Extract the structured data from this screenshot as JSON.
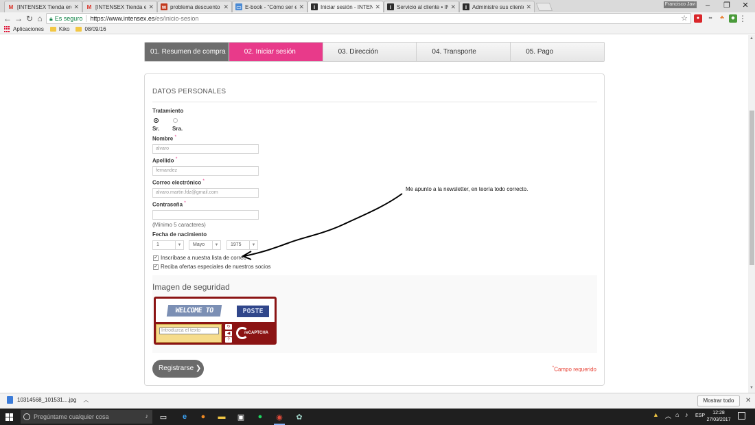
{
  "browser": {
    "tabs": [
      {
        "title": "[INTENSEX Tienda eróti",
        "favicon": "gmail-icon",
        "active": false
      },
      {
        "title": "[INTENSEX Tienda eróti",
        "favicon": "gmail-icon",
        "active": false
      },
      {
        "title": "problema descuento pr",
        "favicon": "forum-icon",
        "active": false
      },
      {
        "title": "E-book - \"Cómo ser el m",
        "favicon": "ebook-icon",
        "active": false
      },
      {
        "title": "Iniciar sesión - INTENSEX",
        "favicon": "intensex-icon",
        "active": true
      },
      {
        "title": "Servicio al cliente • INTE",
        "favicon": "intensex-icon",
        "active": false
      },
      {
        "title": "Administre sus clientes -",
        "favicon": "intensex-icon",
        "active": false
      }
    ],
    "window_user": "Francisco Javi",
    "address": {
      "secure_label": "Es seguro",
      "url_host": "https://www.intensex.es",
      "url_path": "/es/inicio-sesion"
    },
    "bookmarks": [
      {
        "label": "Aplicaciones",
        "icon": "apps-icon"
      },
      {
        "label": "Kiko",
        "icon": "folder-icon"
      },
      {
        "label": "08/09/16",
        "icon": "folder-icon"
      }
    ]
  },
  "checkout": {
    "steps": [
      {
        "label": "01. Resumen de compra",
        "state": "done"
      },
      {
        "label": "02. Iniciar sesión",
        "state": "active"
      },
      {
        "label": "03. Dirección",
        "state": "pending"
      },
      {
        "label": "04. Transporte",
        "state": "pending"
      },
      {
        "label": "05. Pago",
        "state": "pending"
      }
    ]
  },
  "form": {
    "section_title": "DATOS PERSONALES",
    "tratamiento_label": "Tratamiento",
    "tratamiento_options": [
      "Sr.",
      "Sra."
    ],
    "tratamiento_selected": "Sr.",
    "nombre_label": "Nombre",
    "nombre_value": "alvaro",
    "apellido_label": "Apellido",
    "apellido_value": "fernandez",
    "email_label": "Correo electrónico",
    "email_value": "alvaro.martin.fdz@gmail.com",
    "password_label": "Contraseña",
    "password_value": "",
    "password_hint": "(Mínimo 5 caracteres)",
    "birth_label": "Fecha de nacimiento",
    "birth_day": "1",
    "birth_month": "Mayo",
    "birth_year": "1975",
    "required_mark": "*",
    "newsletter_label": "Inscríbase a nuestra lista de correo",
    "newsletter_checked": true,
    "offers_label": "Reciba ofertas especiales de nuestros socios",
    "offers_checked": true,
    "captcha_title": "Imagen de seguridad",
    "captcha_word1": "WELCOME TO",
    "captcha_word2": "POSTE",
    "captcha_placeholder": "Introduzca el texto",
    "captcha_brand": "reCAPTCHA",
    "register_label": "Registrarse",
    "required_note": "Campo requerido"
  },
  "annotation": {
    "text": "Me apunto a la newsletter, en teoría todo correcto."
  },
  "downloads": {
    "file_name": "10314568_101531....jpg",
    "show_all_label": "Mostrar todo"
  },
  "taskbar": {
    "search_placeholder": "Pregúntame cualquier cosa",
    "language": "ESP",
    "time": "12:28",
    "date": "27/03/2017"
  },
  "colors": {
    "accent": "#e83a8a",
    "step_done": "#6d6d6d",
    "required": "#e8463a",
    "recaptcha": "#8b1414"
  }
}
